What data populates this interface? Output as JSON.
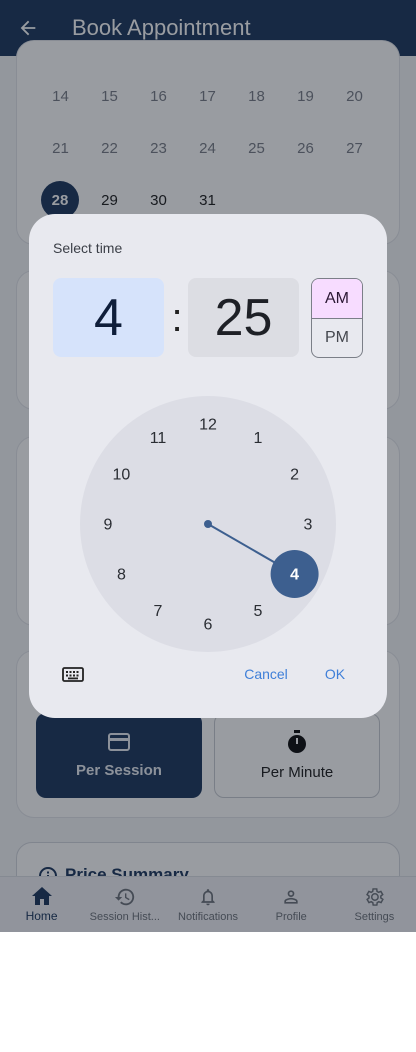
{
  "appbar": {
    "title": "Book Appointment"
  },
  "calendar": {
    "rows": [
      [
        "14",
        "15",
        "16",
        "17",
        "18",
        "19",
        "20"
      ],
      [
        "21",
        "22",
        "23",
        "24",
        "25",
        "26",
        "27"
      ],
      [
        "28",
        "29",
        "30",
        "31"
      ]
    ],
    "selected": "28"
  },
  "rate_options": {
    "per_session": "Per Session",
    "per_minute": "Per Minute"
  },
  "price_summary": {
    "title": "Price Summary"
  },
  "nav": {
    "items": [
      {
        "label": "Home",
        "icon": "home-icon"
      },
      {
        "label": "Session Hist...",
        "icon": "history-icon"
      },
      {
        "label": "Notifications",
        "icon": "bell-icon"
      },
      {
        "label": "Profile",
        "icon": "person-icon"
      },
      {
        "label": "Settings",
        "icon": "gear-icon"
      }
    ]
  },
  "time_picker": {
    "help_text": "Select time",
    "hour": "4",
    "separator": ":",
    "minute": "25",
    "am_label": "AM",
    "pm_label": "PM",
    "period": "AM",
    "dial_numbers": [
      "12",
      "1",
      "2",
      "3",
      "4",
      "5",
      "6",
      "7",
      "8",
      "9",
      "10",
      "11"
    ],
    "selected_hour": 4,
    "cancel_label": "Cancel",
    "ok_label": "OK",
    "accent_color": "#3d5f8f"
  }
}
